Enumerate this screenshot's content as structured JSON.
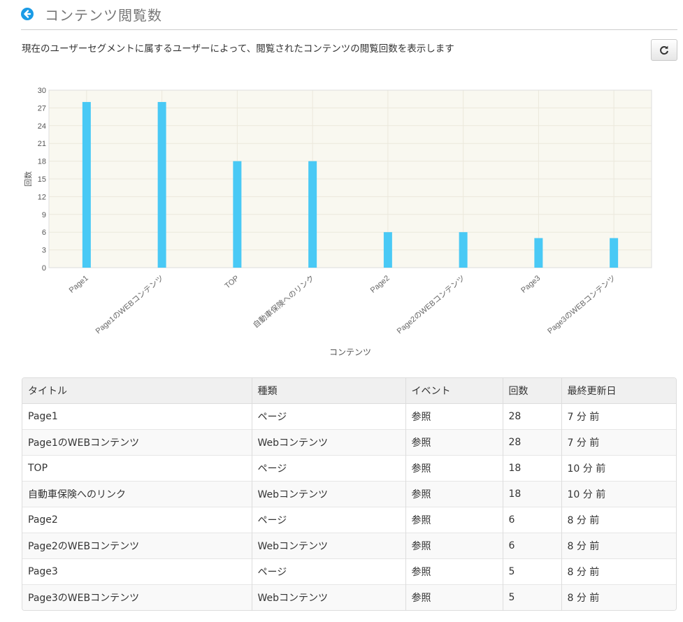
{
  "header": {
    "title": "コンテンツ閲覧数"
  },
  "description": "現在のユーザーセグメントに属するユーザーによって、閲覧されたコンテンツの閲覧回数を表示します",
  "icons": {
    "back": "arrow-left-circle-icon",
    "refresh": "refresh-icon"
  },
  "colors": {
    "bar": "#49c9f5",
    "accent": "#1a9be6",
    "plot_bg": "#f9f8f0"
  },
  "chart_data": {
    "type": "bar",
    "categories": [
      "Page1",
      "Page1のWEBコンテンツ",
      "TOP",
      "自動車保険へのリンク",
      "Page2",
      "Page2のWEBコンテンツ",
      "Page3",
      "Page3のWEBコンテンツ"
    ],
    "values": [
      28,
      28,
      18,
      18,
      6,
      6,
      5,
      5
    ],
    "xlabel": "コンテンツ",
    "ylabel": "回数",
    "ylim": [
      0,
      30
    ],
    "yticks": [
      0,
      3,
      6,
      9,
      12,
      15,
      18,
      21,
      24,
      27,
      30
    ],
    "grid": true
  },
  "table": {
    "headers": [
      "タイトル",
      "種類",
      "イベント",
      "回数",
      "最終更新日"
    ],
    "rows": [
      [
        "Page1",
        "ページ",
        "参照",
        "28",
        "7 分 前"
      ],
      [
        "Page1のWEBコンテンツ",
        "Webコンテンツ",
        "参照",
        "28",
        "7 分 前"
      ],
      [
        "TOP",
        "ページ",
        "参照",
        "18",
        "10 分 前"
      ],
      [
        "自動車保険へのリンク",
        "Webコンテンツ",
        "参照",
        "18",
        "10 分 前"
      ],
      [
        "Page2",
        "ページ",
        "参照",
        "6",
        "8 分 前"
      ],
      [
        "Page2のWEBコンテンツ",
        "Webコンテンツ",
        "参照",
        "6",
        "8 分 前"
      ],
      [
        "Page3",
        "ページ",
        "参照",
        "5",
        "8 分 前"
      ],
      [
        "Page3のWEBコンテンツ",
        "Webコンテンツ",
        "参照",
        "5",
        "8 分 前"
      ]
    ]
  }
}
